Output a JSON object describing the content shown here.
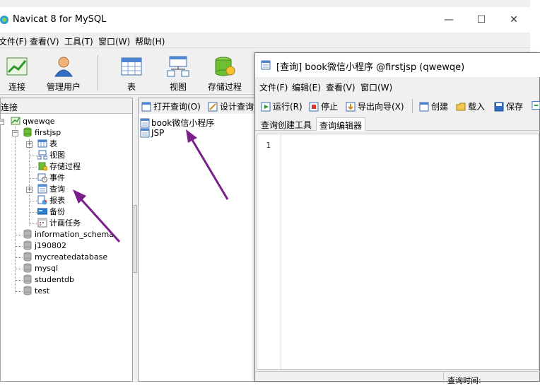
{
  "main_window": {
    "title": "Navicat 8 for MySQL",
    "controls": {
      "minimize": "—",
      "maximize": "☐",
      "close": "✕"
    },
    "menu": [
      "文件(F)",
      "查看(V)",
      "工具(T)",
      "窗口(W)",
      "帮助(H)"
    ],
    "toolbar": [
      {
        "label": "连接",
        "icon": "connect-icon"
      },
      {
        "label": "管理用户",
        "icon": "user-icon"
      },
      {
        "label": "表",
        "icon": "table-icon"
      },
      {
        "label": "视图",
        "icon": "view-icon"
      },
      {
        "label": "存储过程",
        "icon": "procedure-icon"
      }
    ]
  },
  "connections": {
    "header": "连接",
    "root": "qwewqe",
    "database": "firstjsp",
    "db_children": [
      "表",
      "视图",
      "存储过程",
      "事件",
      "查询",
      "报表",
      "备份",
      "计画任务"
    ],
    "other_databases": [
      "information_schema",
      "j190802",
      "mycreatedatabase",
      "mysql",
      "studentdb",
      "test"
    ]
  },
  "objects": {
    "toolbar": [
      "打开查询(O)",
      "设计查询"
    ],
    "items": [
      "book微信小程序",
      "JSP"
    ]
  },
  "query_window": {
    "title": "[查询] book微信小程序 @firstjsp (qwewqe)",
    "menu": [
      "文件(F)",
      "编辑(E)",
      "查看(V)",
      "窗口(W)"
    ],
    "toolbar": [
      "运行(R)",
      "停止",
      "导出向导(X)",
      "创建",
      "载入",
      "保存"
    ],
    "tabs": [
      "查询创建工具",
      "查询编辑器"
    ],
    "active_tab": "查询编辑器",
    "line_number": "1",
    "status": "查询时间:"
  },
  "colors": {
    "annotation_arrow": "#7b1f8c",
    "window_bg": "#f0f0f0",
    "db_icon": "#a8a8a8"
  }
}
